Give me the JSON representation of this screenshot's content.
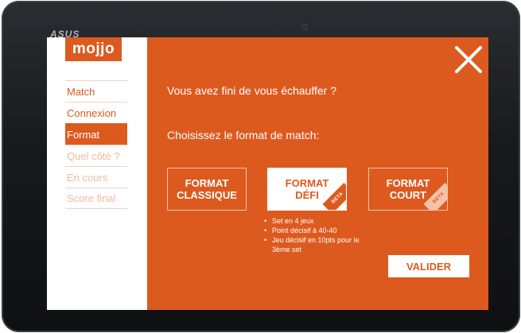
{
  "device": {
    "brand": "ASUS"
  },
  "logo": {
    "text": "mojjo"
  },
  "sidebar": {
    "items": [
      {
        "label": "Match",
        "state": "done"
      },
      {
        "label": "Connexion",
        "state": "done"
      },
      {
        "label": "Format",
        "state": "active"
      },
      {
        "label": "Quel côté ?",
        "state": "disabled"
      },
      {
        "label": "En cours",
        "state": "disabled"
      },
      {
        "label": "Score final",
        "state": "disabled"
      }
    ]
  },
  "main": {
    "question_warmup": "Vous avez fini de vous échauffer ?",
    "question_format": "Choisissez le format de match:",
    "formats": [
      {
        "line1": "FORMAT",
        "line2": "CLASSIQUE",
        "badge": "",
        "selected": false
      },
      {
        "line1": "FORMAT",
        "line2": "DÉFI",
        "badge": "BETA",
        "selected": true
      },
      {
        "line1": "FORMAT",
        "line2": "COURT",
        "badge": "BETA",
        "selected": false
      }
    ],
    "details": [
      "Set en 4 jeux",
      "Point décisif à 40-40",
      "Jeu décisif en 10pts pour le 3ème set"
    ],
    "validate_label": "VALIDER"
  },
  "colors": {
    "accent": "#dd5a1f",
    "accent_light": "#f3c2a8",
    "background": "#ffffff"
  },
  "icons": {
    "close": "close-icon"
  }
}
